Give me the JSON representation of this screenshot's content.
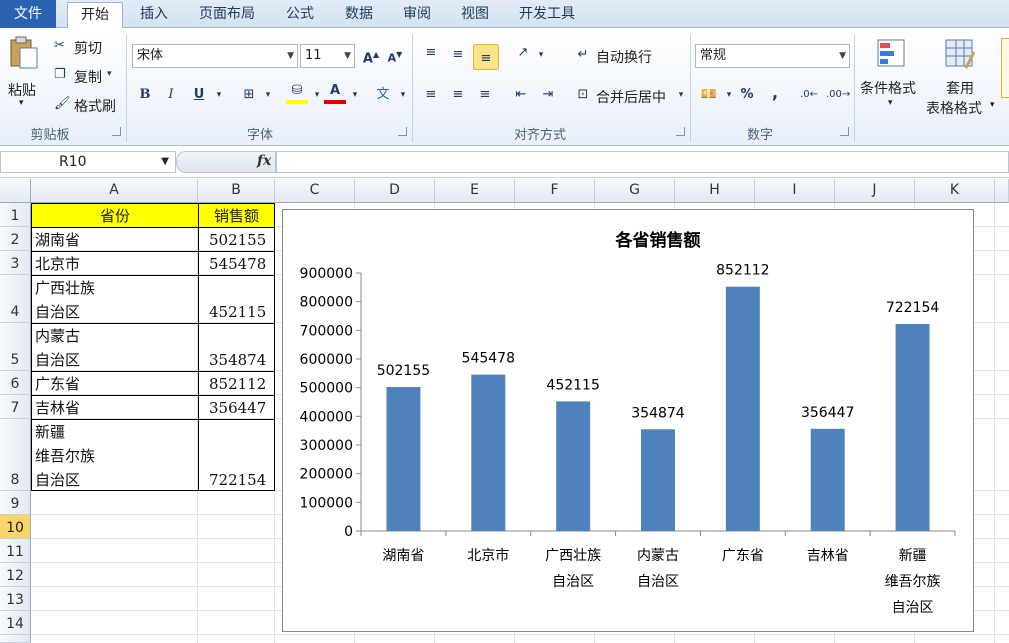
{
  "ribbon": {
    "tabs": [
      "文件",
      "开始",
      "插入",
      "页面布局",
      "公式",
      "数据",
      "审阅",
      "视图",
      "开发工具"
    ],
    "clipboard": {
      "paste": "粘贴",
      "cut": "剪切",
      "copy": "复制",
      "format_painter": "格式刷",
      "label": "剪贴板"
    },
    "font": {
      "name": "宋体",
      "size": "11",
      "bold": "B",
      "italic": "I",
      "underline": "U",
      "label": "字体"
    },
    "alignment": {
      "wrap_text": "自动换行",
      "merge_center": "合并后居中",
      "label": "对齐方式"
    },
    "number": {
      "format": "常规",
      "percent": "%",
      "comma": ",",
      "label": "数字"
    },
    "styles": {
      "conditional": "条件格式",
      "table_format_1": "套用",
      "table_format_2": "表格格式"
    }
  },
  "formula_bar": {
    "name_box": "R10",
    "fx": "fx",
    "formula": ""
  },
  "columns": [
    "A",
    "B",
    "C",
    "D",
    "E",
    "F",
    "G",
    "H",
    "I",
    "J",
    "K"
  ],
  "rows": [
    "1",
    "2",
    "3",
    "4",
    "5",
    "6",
    "7",
    "8",
    "9",
    "10",
    "11",
    "12",
    "13",
    "14"
  ],
  "selected_row": "10",
  "table": {
    "header": [
      "省份",
      "销售额"
    ],
    "rows": [
      {
        "province": "湖南省",
        "sales": "502155"
      },
      {
        "province": "北京市",
        "sales": "545478"
      },
      {
        "province": "广西壮族\n自治区",
        "sales": "452115"
      },
      {
        "province": "内蒙古\n自治区",
        "sales": "354874"
      },
      {
        "province": "广东省",
        "sales": "852112"
      },
      {
        "province": "吉林省",
        "sales": "356447"
      },
      {
        "province": "新疆\n维吾尔族\n自治区",
        "sales": "722154"
      }
    ]
  },
  "chart_data": {
    "type": "bar",
    "title": "各省销售额",
    "categories": [
      "湖南省",
      "北京市",
      "广西壮族\n自治区",
      "内蒙古\n自治区",
      "广东省",
      "吉林省",
      "新疆\n维吾尔族\n自治区"
    ],
    "values": [
      502155,
      545478,
      452115,
      354874,
      852112,
      356447,
      722154
    ],
    "ylim": [
      0,
      900000
    ],
    "yticks": [
      0,
      100000,
      200000,
      300000,
      400000,
      500000,
      600000,
      700000,
      800000,
      900000
    ],
    "bar_color": "#4f81bd",
    "grid": false,
    "legend": "none",
    "data_labels": true
  }
}
